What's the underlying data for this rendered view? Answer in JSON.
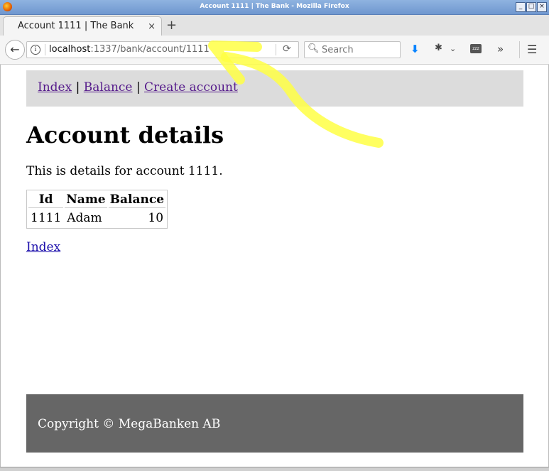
{
  "window": {
    "title": "Account 1111 | The Bank - Mozilla Firefox"
  },
  "tab": {
    "label": "Account 1111 | The Bank",
    "close": "×",
    "new_tab": "+"
  },
  "navbar": {
    "back": "←",
    "url_host": "localhost",
    "url_rest": ":1337/bank/account/1111",
    "search_placeholder": "Search",
    "overflow": "»"
  },
  "page": {
    "nav": {
      "index": "Index",
      "balance": "Balance",
      "create_account": "Create account",
      "separator": "|"
    },
    "heading": "Account details",
    "description": "This is details for account 1111.",
    "table": {
      "headers": [
        "Id",
        "Name",
        "Balance"
      ],
      "rows": [
        [
          "1111",
          "Adam",
          "10"
        ]
      ]
    },
    "index_link": "Index",
    "footer": "Copyright © MegaBanken AB"
  },
  "colors": {
    "annotation": "#ffff44",
    "footer_bg": "#666666",
    "nav_bg": "#dcdcdc"
  }
}
